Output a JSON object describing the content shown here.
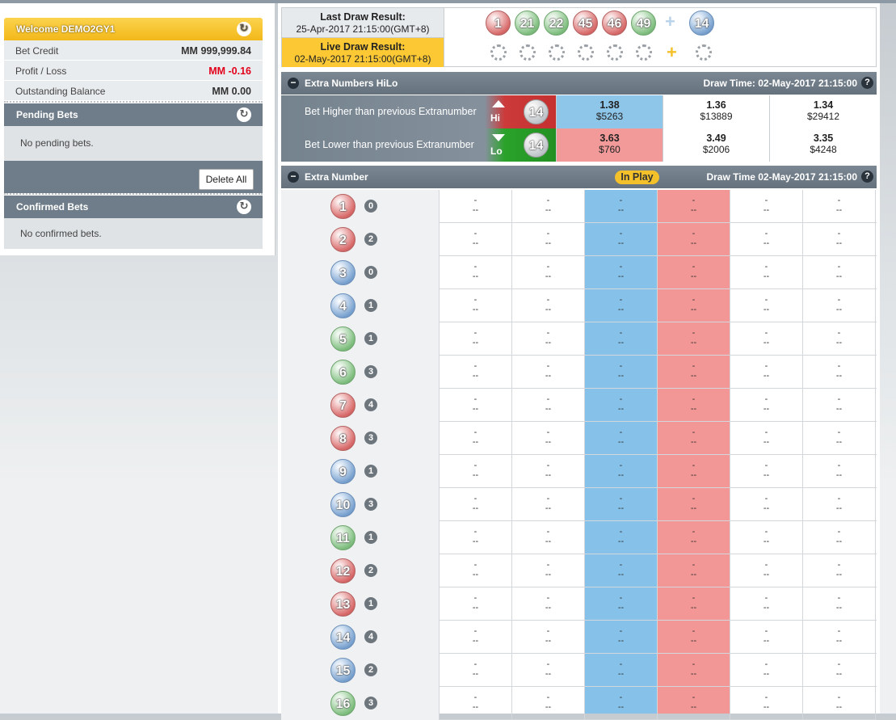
{
  "account": {
    "welcome": "Welcome DEMO2GY1",
    "rows": [
      {
        "label": "Bet Credit",
        "value": "MM 999,999.84"
      },
      {
        "label": "Profit / Loss",
        "value": "MM -0.16"
      },
      {
        "label": "Outstanding Balance",
        "value": "MM 0.00"
      }
    ]
  },
  "pending": {
    "title": "Pending Bets",
    "empty": "No pending bets.",
    "delete_label": "Delete All"
  },
  "confirmed": {
    "title": "Confirmed Bets",
    "empty": "No confirmed bets."
  },
  "draw": {
    "last_label": "Last Draw Result:",
    "last_date": "25-Apr-2017 21:15:00(GMT+8)",
    "last_balls": [
      {
        "n": "1",
        "c": "red"
      },
      {
        "n": "21",
        "c": "green"
      },
      {
        "n": "22",
        "c": "green"
      },
      {
        "n": "45",
        "c": "red"
      },
      {
        "n": "46",
        "c": "red"
      },
      {
        "n": "49",
        "c": "green"
      }
    ],
    "last_extra": {
      "n": "14",
      "c": "blue"
    },
    "plus": "+",
    "live_label": "Live Draw Result:",
    "live_date": "02-May-2017 21:15:00(GMT+8)"
  },
  "hilo": {
    "title": "Extra Numbers HiLo",
    "draw_time": "Draw Time: 02-May-2017 21:15:00",
    "help": "?",
    "minus": "−",
    "rows": [
      {
        "label": "Bet Higher than previous Extranumber",
        "tag": "Hi",
        "ball": "14",
        "odds": [
          {
            "o": "1.38",
            "s": "$5263"
          },
          {
            "o": "1.36",
            "s": "$13889"
          },
          {
            "o": "1.34",
            "s": "$29412"
          }
        ]
      },
      {
        "label": "Bet Lower than previous Extranumber",
        "tag": "Lo",
        "ball": "14",
        "odds": [
          {
            "o": "3.63",
            "s": "$760"
          },
          {
            "o": "3.49",
            "s": "$2006"
          },
          {
            "o": "3.35",
            "s": "$4248"
          }
        ]
      }
    ]
  },
  "extra": {
    "title": "Extra Number",
    "status": "In Play",
    "draw_time": "Draw Time 02-May-2017 21:15:00",
    "help": "?",
    "minus": "−",
    "cell_top": "-",
    "cell_bottom": "--",
    "rows": [
      {
        "n": "1",
        "c": "red",
        "count": "0"
      },
      {
        "n": "2",
        "c": "red",
        "count": "2"
      },
      {
        "n": "3",
        "c": "blue",
        "count": "0"
      },
      {
        "n": "4",
        "c": "blue",
        "count": "1"
      },
      {
        "n": "5",
        "c": "green",
        "count": "1"
      },
      {
        "n": "6",
        "c": "green",
        "count": "3"
      },
      {
        "n": "7",
        "c": "red",
        "count": "4"
      },
      {
        "n": "8",
        "c": "red",
        "count": "3"
      },
      {
        "n": "9",
        "c": "blue",
        "count": "1"
      },
      {
        "n": "10",
        "c": "blue",
        "count": "3"
      },
      {
        "n": "11",
        "c": "green",
        "count": "1"
      },
      {
        "n": "12",
        "c": "red",
        "count": "2"
      },
      {
        "n": "13",
        "c": "red",
        "count": "1"
      },
      {
        "n": "14",
        "c": "blue",
        "count": "4"
      },
      {
        "n": "15",
        "c": "blue",
        "count": "2"
      },
      {
        "n": "16",
        "c": "green",
        "count": "3"
      }
    ]
  },
  "colors": {
    "accent_yellow": "#f3b819",
    "header_grey": "#6f7d8a",
    "hi_red": "#c53030",
    "lo_green": "#239023",
    "col_blue": "#85c1e8",
    "col_pink": "#f29696"
  }
}
